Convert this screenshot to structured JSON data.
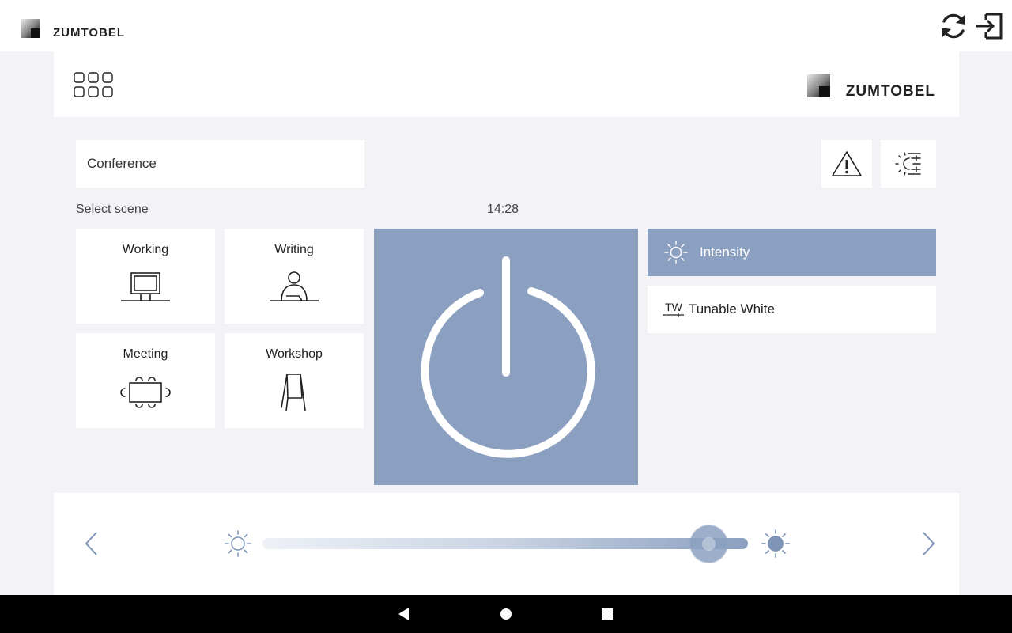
{
  "brand": {
    "name": "ZUMTOBEL"
  },
  "room": {
    "name": "Conference"
  },
  "scenes_label": "Select scene",
  "clock": "14:28",
  "scenes": [
    {
      "label": "Working",
      "icon": "monitor-desk-icon"
    },
    {
      "label": "Writing",
      "icon": "person-writing-icon"
    },
    {
      "label": "Meeting",
      "icon": "meeting-table-icon"
    },
    {
      "label": "Workshop",
      "icon": "flipchart-icon"
    }
  ],
  "modes": [
    {
      "label": "Intensity",
      "icon": "sun-icon",
      "active": true
    },
    {
      "label": "Tunable White",
      "icon_text": "TW",
      "active": false
    }
  ],
  "slider": {
    "value": 0.92
  },
  "colors": {
    "accent": "#8ba0c0",
    "background": "#f2f2f7",
    "card": "#ffffff",
    "icon_stroke": "#222222",
    "arrow": "#7f95b8"
  },
  "icons": {
    "refresh": "refresh-icon",
    "logout": "logout-icon",
    "apps": "apps-grid-icon",
    "warning": "warning-icon",
    "light_settings": "light-settings-icon",
    "power": "power-icon"
  }
}
